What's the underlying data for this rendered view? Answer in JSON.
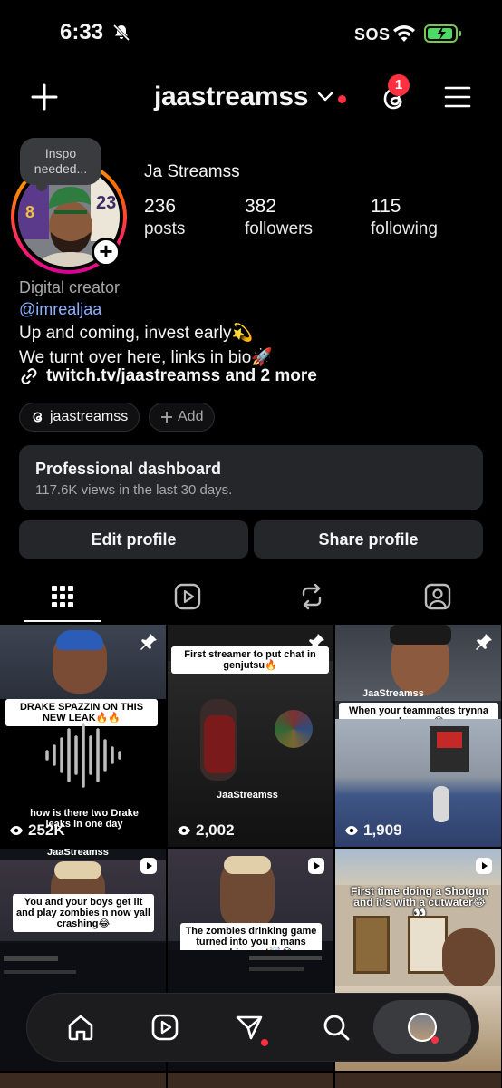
{
  "status_bar": {
    "time": "6:33",
    "sos": "SOS"
  },
  "header": {
    "username": "jaastreamss",
    "notification_count": "1"
  },
  "profile": {
    "note": "Inspo needed...",
    "display_name": "Ja Streamss",
    "stats": [
      {
        "value": "236",
        "label": "posts"
      },
      {
        "value": "382",
        "label": "followers"
      },
      {
        "value": "115",
        "label": "following"
      }
    ],
    "category": "Digital creator",
    "mention": "@imrealjaa",
    "bio_lines": [
      "Up and coming, invest early💫",
      "We turnt over here, links in bio🚀"
    ],
    "link": "twitch.tv/jaastreamss and 2 more",
    "threads_chip": "jaastreamss",
    "add_chip": "Add"
  },
  "dashboard": {
    "title": "Professional dashboard",
    "subtitle": "117.6K views in the last 30 days."
  },
  "buttons": {
    "edit": "Edit profile",
    "share": "Share profile"
  },
  "grid": {
    "tiles": [
      {
        "caption": "DRAKE SPAZZIN ON THIS NEW LEAK🔥🔥",
        "subtext": "how is there two Drake leaks in one day",
        "views": "252K"
      },
      {
        "caption": "First streamer to put chat in genjutsu🔥",
        "watermark": "JaaStreamss",
        "views": "2,002"
      },
      {
        "caption": "When your teammates trynna play you😂",
        "watermark": "JaaStreamss",
        "views": "1,909"
      },
      {
        "caption": "You and your boys get lit and play zombies n now yall crashing😂",
        "watermark": "JaaStreamss"
      },
      {
        "caption": "The zombies drinking game turned into you n mans crashing out🤯😂"
      },
      {
        "caption": "First time doing a Shotgun and it's with a cutwater😂👀"
      }
    ]
  },
  "colors": {
    "accent_red": "#ff3040",
    "card_bg": "#25262a",
    "link_blue": "#8fb0ff"
  }
}
